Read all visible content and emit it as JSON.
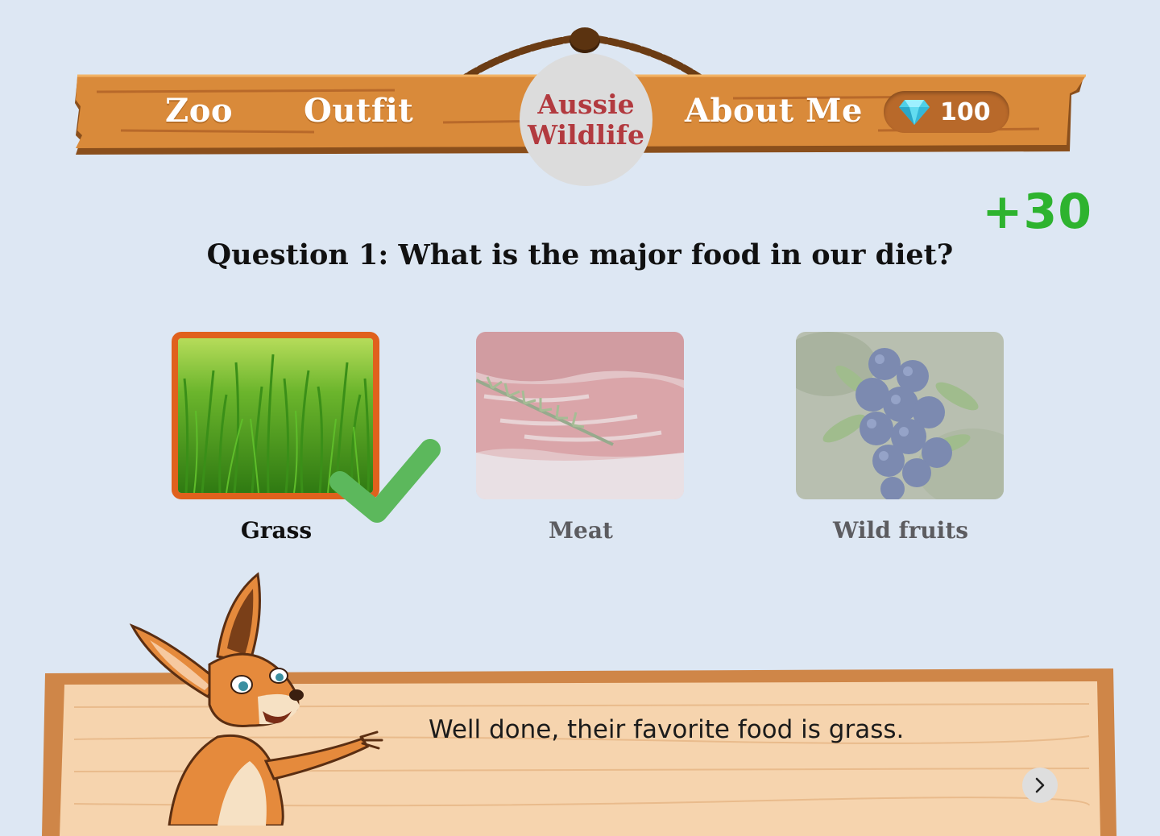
{
  "header": {
    "nav": {
      "zoo": "Zoo",
      "outfit": "Outfit",
      "about": "About Me"
    },
    "logo": {
      "line1": "Aussie",
      "line2": "Wildlife",
      "color": "#b23a3f"
    },
    "gems": {
      "icon": "diamond-icon",
      "count": "100"
    }
  },
  "score_change": "+30",
  "question": "Question 1: What is the major food in our diet?",
  "options": [
    {
      "label": "Grass",
      "selected": true,
      "correct": true,
      "image": "grass-photo"
    },
    {
      "label": "Meat",
      "selected": false,
      "image": "meat-photo"
    },
    {
      "label": "Wild fruits",
      "selected": false,
      "image": "berries-photo"
    }
  ],
  "feedback": {
    "message": "Well done, their favorite food is grass.",
    "next_icon": "chevron-right-icon",
    "character": "kangaroo-mascot"
  },
  "colors": {
    "background": "#dde7f3",
    "wood": "#d98a3a",
    "selected_border": "#e0611d",
    "score": "#2eb32f",
    "check": "#5cb85c"
  }
}
